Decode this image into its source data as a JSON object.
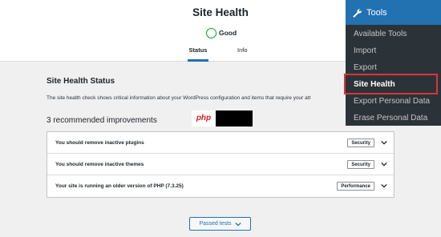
{
  "page": {
    "title": "Site Health",
    "score_label": "Good",
    "tabs": [
      {
        "label": "Status"
      },
      {
        "label": "Info"
      }
    ]
  },
  "status": {
    "heading": "Site Health Status",
    "description": "The site health check shows critical information about your WordPress configuration and items that require your att",
    "improvements_heading": "3 recommended improvements",
    "issues": [
      {
        "text": "You should remove inactive plugins",
        "badge": "Security"
      },
      {
        "text": "You should remove inactive themes",
        "badge": "Security"
      },
      {
        "text": "Your site is running an older version of PHP (7.3.25)",
        "badge": "Performance"
      }
    ],
    "passed_button": "Passed tests"
  },
  "watermark": {
    "logo_text": "php"
  },
  "menu": {
    "heading": "Tools",
    "items": [
      "Available Tools",
      "Import",
      "Export",
      "Site Health",
      "Export Personal Data",
      "Erase Personal Data"
    ]
  },
  "colors": {
    "accent": "#2271b1",
    "good": "#00a32a",
    "highlight": "#d63638",
    "menu_bg": "#2c3338"
  }
}
